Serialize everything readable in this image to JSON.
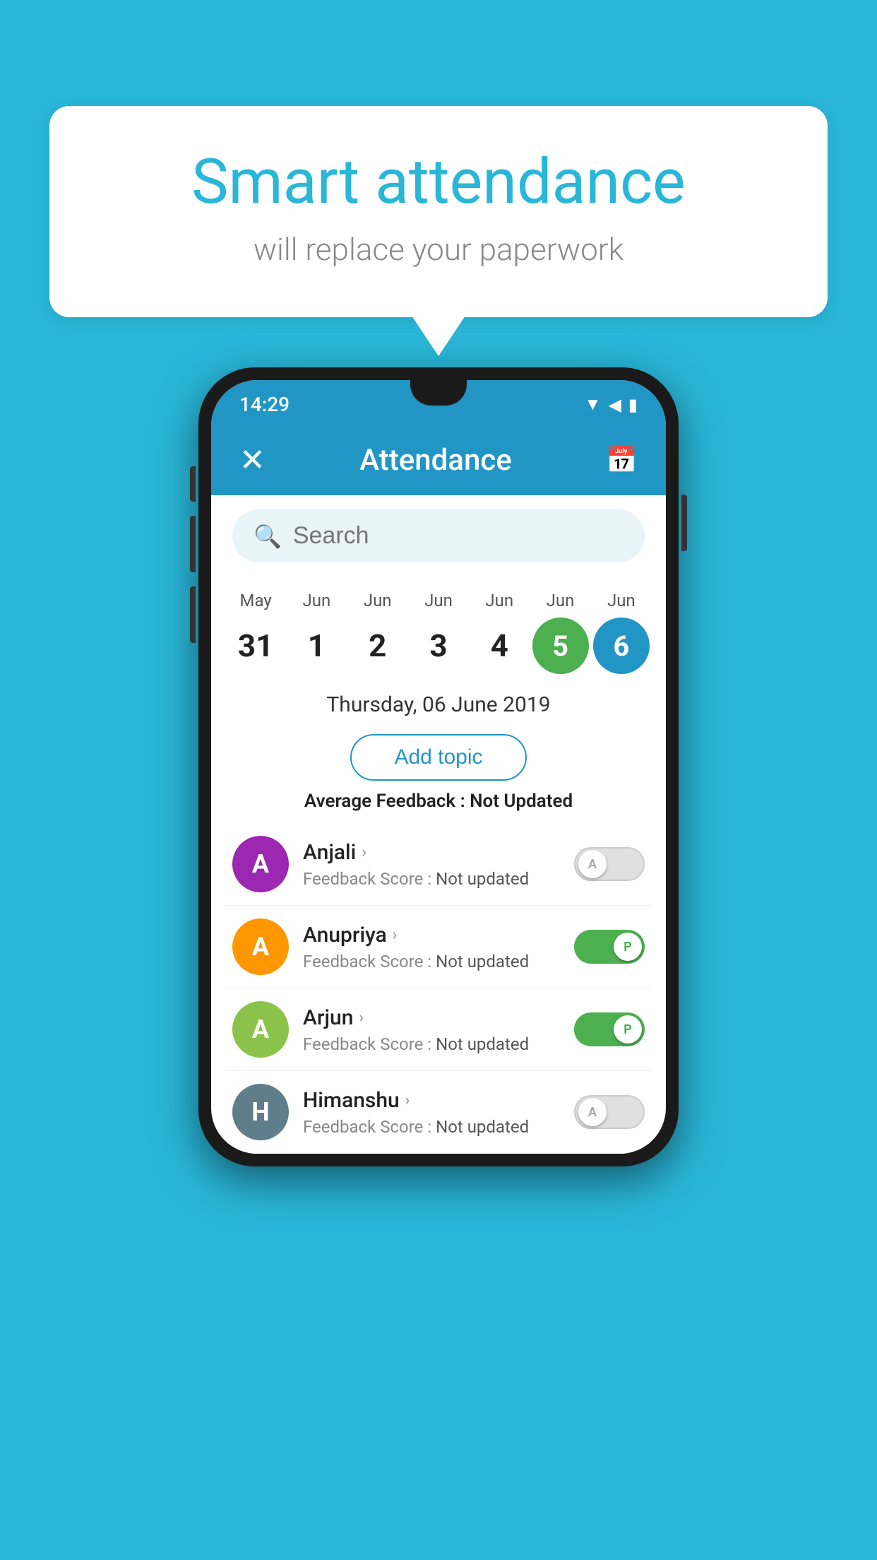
{
  "background_color": "#29b6d8",
  "speech_bubble": {
    "title": "Smart attendance",
    "subtitle": "will replace your paperwork"
  },
  "status_bar": {
    "time": "14:29",
    "icons": [
      "▼",
      "◀",
      "▮"
    ]
  },
  "app_bar": {
    "title": "Attendance",
    "close_icon": "✕",
    "calendar_icon": "📅"
  },
  "search": {
    "placeholder": "Search"
  },
  "calendar": {
    "days": [
      {
        "month": "May",
        "date": "31",
        "style": "normal"
      },
      {
        "month": "Jun",
        "date": "1",
        "style": "normal"
      },
      {
        "month": "Jun",
        "date": "2",
        "style": "normal"
      },
      {
        "month": "Jun",
        "date": "3",
        "style": "normal"
      },
      {
        "month": "Jun",
        "date": "4",
        "style": "normal"
      },
      {
        "month": "Jun",
        "date": "5",
        "style": "green"
      },
      {
        "month": "Jun",
        "date": "6",
        "style": "blue"
      }
    ]
  },
  "selected_date": "Thursday, 06 June 2019",
  "add_topic_label": "Add topic",
  "avg_feedback_label": "Average Feedback :",
  "avg_feedback_value": "Not Updated",
  "students": [
    {
      "name": "Anjali",
      "avatar_letter": "A",
      "avatar_color": "purple",
      "feedback_label": "Feedback Score :",
      "feedback_value": "Not updated",
      "toggle": "off",
      "toggle_letter": "A"
    },
    {
      "name": "Anupriya",
      "avatar_letter": "A",
      "avatar_color": "orange",
      "feedback_label": "Feedback Score :",
      "feedback_value": "Not updated",
      "toggle": "on",
      "toggle_letter": "P"
    },
    {
      "name": "Arjun",
      "avatar_letter": "A",
      "avatar_color": "light-green",
      "feedback_label": "Feedback Score :",
      "feedback_value": "Not updated",
      "toggle": "on",
      "toggle_letter": "P"
    },
    {
      "name": "Himanshu",
      "avatar_letter": "H",
      "avatar_color": "teal",
      "feedback_label": "Feedback Score :",
      "feedback_value": "Not updated",
      "toggle": "off",
      "toggle_letter": "A"
    }
  ]
}
